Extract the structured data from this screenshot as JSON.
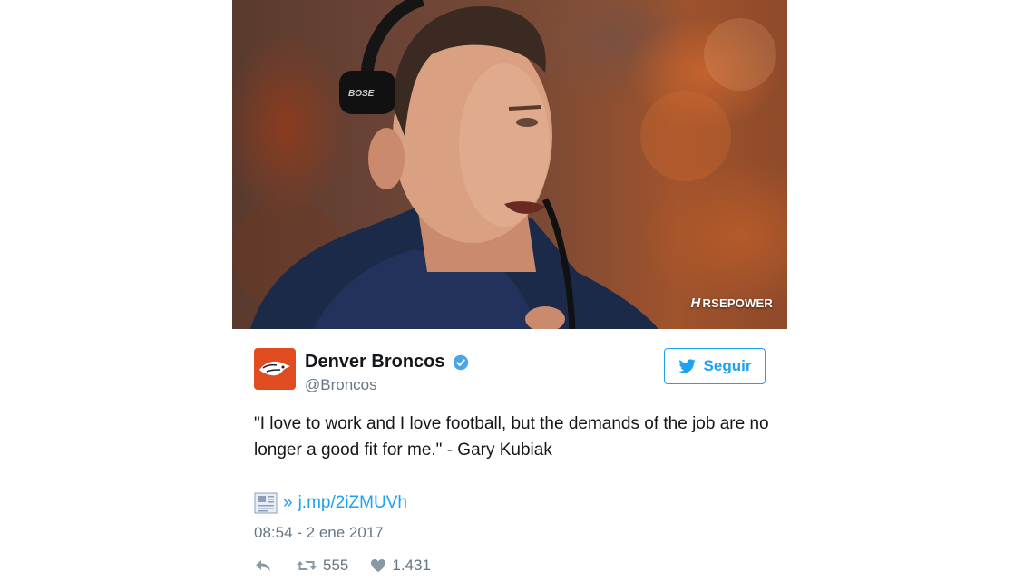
{
  "photo": {
    "headset_brand": "BOSE",
    "watermark": "RSEPOWER",
    "watermark_mark": "H"
  },
  "account": {
    "name": "Denver Broncos",
    "handle": "@Broncos",
    "verified": true,
    "avatar_color": "#e04b1f"
  },
  "follow_button": {
    "label": "Seguir"
  },
  "tweet": {
    "text": "\"I love to work and I love football, but the demands of the job are no longer a good fit for me.\" - Gary Kubiak",
    "link_prefix": "»",
    "link": "j.mp/2iZMUVh",
    "timestamp": "08:54 - 2 ene 2017"
  },
  "actions": {
    "retweets": "555",
    "likes": "1.431"
  },
  "colors": {
    "accent": "#1da1f2",
    "secondary_text": "#657786",
    "primary_text": "#14171a"
  },
  "icons": [
    "twitter-bird-icon",
    "verified-icon",
    "news-icon",
    "reply-icon",
    "retweet-icon",
    "heart-icon"
  ]
}
